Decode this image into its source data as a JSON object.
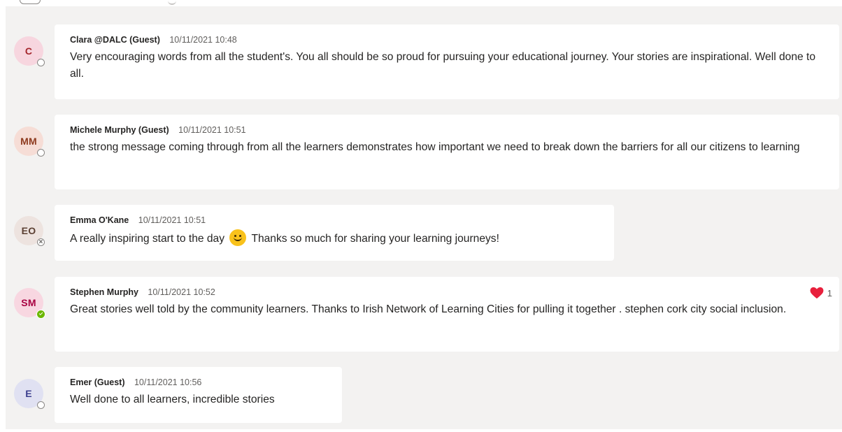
{
  "messages": [
    {
      "initials": "C",
      "author": "Clara @DALC (Guest)",
      "time": "10/11/2021 10:48",
      "text": "Very encouraging words from all the student's. You all should be so proud for pursuing your educational journey. Your stories are inspirational. Well done to all.",
      "avatar_bg": "#f7d6df",
      "avatar_fg": "#a4262c",
      "presence": "away-empty"
    },
    {
      "initials": "MM",
      "author": "Michele Murphy (Guest)",
      "time": "10/11/2021 10:51",
      "text": "the strong message coming through from all the learners demonstrates how important we need to break down the barriers for all our citizens to learning",
      "avatar_bg": "#f6ddd6",
      "avatar_fg": "#8e3b1f",
      "presence": "away-empty"
    },
    {
      "initials": "EO",
      "author": "Emma O'Kane",
      "time": "10/11/2021 10:51",
      "text_before": "A really inspiring start to the day",
      "emoji": "slightly-smiling-face",
      "text_after": "Thanks so much for sharing your learning journeys!",
      "avatar_bg": "#ede3df",
      "avatar_fg": "#5c4033",
      "presence": "offline"
    },
    {
      "initials": "SM",
      "author": "Stephen Murphy",
      "time": "10/11/2021 10:52",
      "text": "Great stories well told by the community learners. Thanks to Irish Network of Learning Cities for pulling it together . stephen cork city social inclusion.",
      "avatar_bg": "#f8d7e1",
      "avatar_fg": "#a80041",
      "presence": "available",
      "reaction": {
        "icon": "heart-icon",
        "count": "1",
        "color": "#e8203c"
      }
    },
    {
      "initials": "E",
      "author": "Emer (Guest)",
      "time": "10/11/2021 10:56",
      "text": "Well done to all learners, incredible stories",
      "avatar_bg": "#e0e1f2",
      "avatar_fg": "#3c3f8f",
      "presence": "away-empty"
    }
  ]
}
